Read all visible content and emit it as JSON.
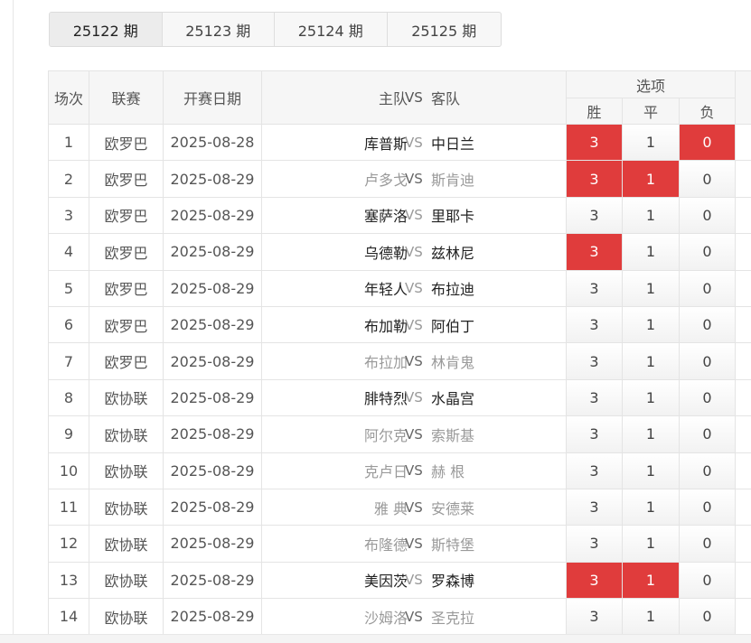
{
  "tabs": [
    {
      "label": "25122 期",
      "active": true
    },
    {
      "label": "25123 期",
      "active": false
    },
    {
      "label": "25124 期",
      "active": false
    },
    {
      "label": "25125 期",
      "active": false
    }
  ],
  "header": {
    "index": "场次",
    "league": "联赛",
    "date": "开赛日期",
    "home": "主队",
    "vs": "VS",
    "away": "客队",
    "options": "选项",
    "win": "胜",
    "draw": "平",
    "lose": "负"
  },
  "colors": {
    "selected": "#e03c3c",
    "header_bg": "#f6f6f6",
    "border": "#e4e4e4"
  },
  "rows": [
    {
      "idx": "1",
      "league": "欧罗巴",
      "date": "2025-08-28",
      "home": "库普斯",
      "away": "中日兰",
      "dim": false,
      "win": "3",
      "draw": "1",
      "lose": "0",
      "sel": [
        true,
        false,
        true
      ]
    },
    {
      "idx": "2",
      "league": "欧罗巴",
      "date": "2025-08-29",
      "home": "卢多戈",
      "away": "斯肯迪",
      "dim": true,
      "win": "3",
      "draw": "1",
      "lose": "0",
      "sel": [
        true,
        true,
        false
      ]
    },
    {
      "idx": "3",
      "league": "欧罗巴",
      "date": "2025-08-29",
      "home": "塞萨洛",
      "away": "里耶卡",
      "dim": false,
      "win": "3",
      "draw": "1",
      "lose": "0",
      "sel": [
        false,
        false,
        false
      ]
    },
    {
      "idx": "4",
      "league": "欧罗巴",
      "date": "2025-08-29",
      "home": "乌德勒",
      "away": "兹林尼",
      "dim": false,
      "win": "3",
      "draw": "1",
      "lose": "0",
      "sel": [
        true,
        false,
        false
      ]
    },
    {
      "idx": "5",
      "league": "欧罗巴",
      "date": "2025-08-29",
      "home": "年轻人",
      "away": "布拉迪",
      "dim": false,
      "win": "3",
      "draw": "1",
      "lose": "0",
      "sel": [
        false,
        false,
        false
      ]
    },
    {
      "idx": "6",
      "league": "欧罗巴",
      "date": "2025-08-29",
      "home": "布加勒",
      "away": "阿伯丁",
      "dim": false,
      "win": "3",
      "draw": "1",
      "lose": "0",
      "sel": [
        false,
        false,
        false
      ]
    },
    {
      "idx": "7",
      "league": "欧罗巴",
      "date": "2025-08-29",
      "home": "布拉加",
      "away": "林肯鬼",
      "dim": true,
      "win": "3",
      "draw": "1",
      "lose": "0",
      "sel": [
        false,
        false,
        false
      ]
    },
    {
      "idx": "8",
      "league": "欧协联",
      "date": "2025-08-29",
      "home": "腓特烈",
      "away": "水晶宫",
      "dim": false,
      "win": "3",
      "draw": "1",
      "lose": "0",
      "sel": [
        false,
        false,
        false
      ]
    },
    {
      "idx": "9",
      "league": "欧协联",
      "date": "2025-08-29",
      "home": "阿尔克",
      "away": "索斯基",
      "dim": true,
      "win": "3",
      "draw": "1",
      "lose": "0",
      "sel": [
        false,
        false,
        false
      ]
    },
    {
      "idx": "10",
      "league": "欧协联",
      "date": "2025-08-29",
      "home": "克卢日",
      "away": "赫 根",
      "dim": true,
      "win": "3",
      "draw": "1",
      "lose": "0",
      "sel": [
        false,
        false,
        false
      ]
    },
    {
      "idx": "11",
      "league": "欧协联",
      "date": "2025-08-29",
      "home": "雅 典",
      "away": "安德莱",
      "dim": true,
      "win": "3",
      "draw": "1",
      "lose": "0",
      "sel": [
        false,
        false,
        false
      ]
    },
    {
      "idx": "12",
      "league": "欧协联",
      "date": "2025-08-29",
      "home": "布隆德",
      "away": "斯特堡",
      "dim": true,
      "win": "3",
      "draw": "1",
      "lose": "0",
      "sel": [
        false,
        false,
        false
      ]
    },
    {
      "idx": "13",
      "league": "欧协联",
      "date": "2025-08-29",
      "home": "美因茨",
      "away": "罗森博",
      "dim": false,
      "win": "3",
      "draw": "1",
      "lose": "0",
      "sel": [
        true,
        true,
        false
      ]
    },
    {
      "idx": "14",
      "league": "欧协联",
      "date": "2025-08-29",
      "home": "沙姆洛",
      "away": "圣克拉",
      "dim": true,
      "win": "3",
      "draw": "1",
      "lose": "0",
      "sel": [
        false,
        false,
        false
      ]
    }
  ]
}
